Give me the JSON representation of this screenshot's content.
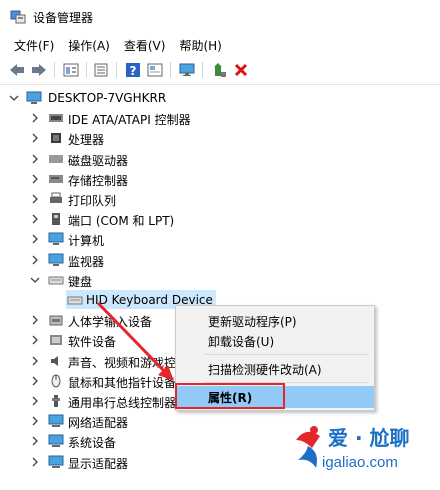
{
  "window": {
    "title": "设备管理器"
  },
  "menu": [
    "文件(F)",
    "操作(A)",
    "查看(V)",
    "帮助(H)"
  ],
  "toolbar": {
    "buttons": [
      "back-icon",
      "forward-icon",
      "properties-icon",
      "list-icon",
      "help-icon",
      "show-icon",
      "monitor-icon",
      "update-driver-icon",
      "remove-icon"
    ]
  },
  "tree": {
    "root": "DESKTOP-7VGHKRR",
    "items": [
      {
        "label": "IDE ATA/ATAPI 控制器",
        "icon": "ide-controller-icon"
      },
      {
        "label": "处理器",
        "icon": "processor-icon"
      },
      {
        "label": "磁盘驱动器",
        "icon": "disk-drive-icon"
      },
      {
        "label": "存储控制器",
        "icon": "storage-controller-icon"
      },
      {
        "label": "打印队列",
        "icon": "printer-icon"
      },
      {
        "label": "端口 (COM 和 LPT)",
        "icon": "port-icon"
      },
      {
        "label": "计算机",
        "icon": "computer-icon"
      },
      {
        "label": "监视器",
        "icon": "monitor-icon"
      },
      {
        "label": "键盘",
        "icon": "keyboard-icon"
      },
      {
        "label": "HID Keyboard Device",
        "icon": "keyboard-device-icon"
      },
      {
        "label": "人体学输入设备",
        "icon": "hid-icon"
      },
      {
        "label": "软件设备",
        "icon": "software-device-icon"
      },
      {
        "label": "声音、视频和游戏控制器",
        "icon": "sound-icon"
      },
      {
        "label": "鼠标和其他指针设备",
        "icon": "mouse-icon"
      },
      {
        "label": "通用串行总线控制器",
        "icon": "usb-icon"
      },
      {
        "label": "网络适配器",
        "icon": "network-adapter-icon"
      },
      {
        "label": "系统设备",
        "icon": "system-device-icon"
      },
      {
        "label": "显示适配器",
        "icon": "display-adapter-icon"
      }
    ]
  },
  "context_menu": {
    "items": [
      "更新驱动程序(P)",
      "卸载设备(U)",
      "扫描检测硬件改动(A)",
      "属性(R)"
    ]
  },
  "watermark": {
    "line1": "爱 · 尬聊",
    "line2": "igaliao.com"
  },
  "colors": {
    "selection": "#cce8ff",
    "menu_highlight": "#91c9f7",
    "highlight_box": "#e4262a",
    "arrow": "#e4262a",
    "watermark_blue": "#1c6fc4",
    "watermark_red": "#e4262a"
  }
}
